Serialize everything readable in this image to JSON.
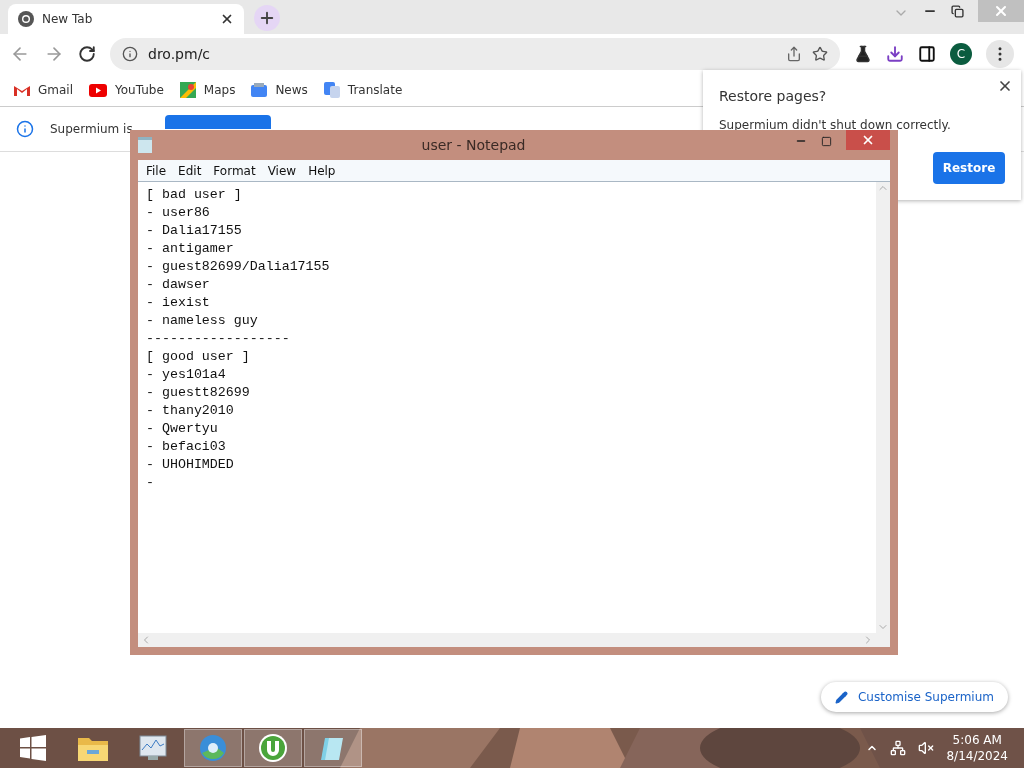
{
  "browser": {
    "tabs": [
      {
        "title": "New Tab",
        "selected": true
      }
    ],
    "address": "dro.pm/c",
    "profile_initial": "C",
    "bookmarks": [
      {
        "kind": "mail",
        "label": "Gmail"
      },
      {
        "kind": "video",
        "label": "YouTube"
      },
      {
        "kind": "map",
        "label": "Maps"
      },
      {
        "kind": "news",
        "label": "News"
      },
      {
        "kind": "translate",
        "label": "Translate"
      }
    ],
    "infobar": {
      "message": "Supermium is"
    },
    "restore_popup": {
      "title": "Restore pages?",
      "message": "Supermium didn't shut down correctly.",
      "button": "Restore"
    },
    "customise_button": "Customise Supermium"
  },
  "notepad": {
    "title": "user - Notepad",
    "menu": [
      "File",
      "Edit",
      "Format",
      "View",
      "Help"
    ],
    "lines": [
      "[ bad user ]",
      "- user86",
      "- Dalia17155",
      "- antigamer",
      "- guest82699/Dalia17155",
      "- dawser",
      "- iexist",
      "- nameless guy",
      "------------------",
      "[ good user ]",
      "- yes101a4",
      "- guestt82699",
      "- thany2010",
      "- Qwertyu",
      "- befaci03",
      "- UHOHIMDED",
      "-"
    ]
  },
  "taskbar": {
    "apps": [
      {
        "kind": "folder",
        "active": false
      },
      {
        "kind": "monitor",
        "active": false
      },
      {
        "kind": "globe",
        "active": true
      },
      {
        "kind": "torrent",
        "active": true
      },
      {
        "kind": "notepad",
        "active": true
      }
    ],
    "time": "5:06 AM",
    "date": "8/14/2024"
  }
}
